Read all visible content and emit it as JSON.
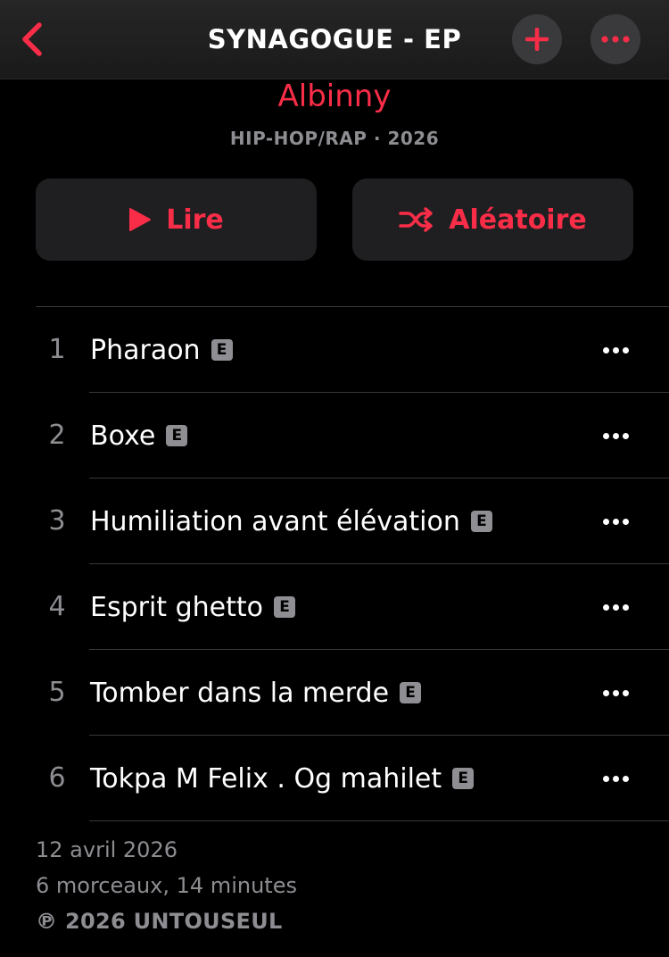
{
  "navbar": {
    "title": "SYNAGOGUE - EP",
    "back_icon": "chevron-left-icon",
    "add_icon": "plus-icon",
    "more_icon": "ellipsis-icon"
  },
  "album": {
    "artist": "Albinny",
    "genre_year": "HIP-HOP/RAP · 2026"
  },
  "actions": {
    "play_label": "Lire",
    "play_icon": "play-icon",
    "shuffle_label": "Aléatoire",
    "shuffle_icon": "shuffle-icon"
  },
  "tracks": [
    {
      "number": "1",
      "title": "Pharaon",
      "explicit": "E"
    },
    {
      "number": "2",
      "title": "Boxe",
      "explicit": "E"
    },
    {
      "number": "3",
      "title": "Humiliation avant élévation",
      "explicit": "E"
    },
    {
      "number": "4",
      "title": "Esprit ghetto",
      "explicit": "E"
    },
    {
      "number": "5",
      "title": "Tomber dans la merde",
      "explicit": "E"
    },
    {
      "number": "6",
      "title": "Tokpa M Felix . Og mahilet",
      "explicit": "E"
    }
  ],
  "footer": {
    "release_date": "12 avril 2026",
    "summary": "6 morceaux, 14 minutes",
    "copyright": "℗ 2026 UNTOUSEUL"
  },
  "colors": {
    "accent": "#fa2d48",
    "background": "#000000",
    "secondary_text": "#8d8d92",
    "button_bg": "#1f1f21"
  }
}
